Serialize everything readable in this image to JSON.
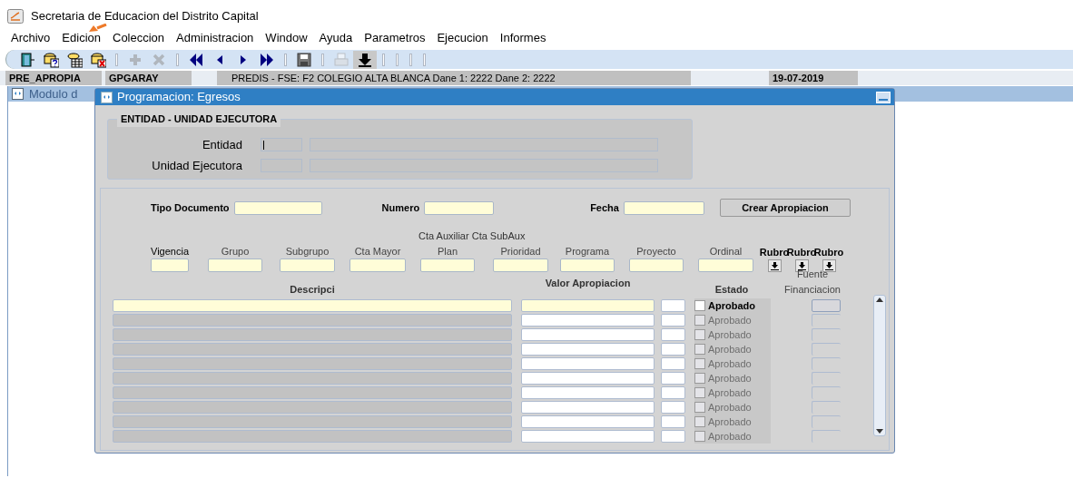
{
  "window": {
    "title": "Secretaria de Educacion del Distrito Capital"
  },
  "menu": [
    {
      "label": "Archivo"
    },
    {
      "label": "Edicion"
    },
    {
      "label": "Coleccion"
    },
    {
      "label": "Administracion"
    },
    {
      "label": "Window"
    },
    {
      "label": "Ayuda"
    },
    {
      "label": "Parametros"
    },
    {
      "label": "Ejecucion"
    },
    {
      "label": "Informes"
    }
  ],
  "toolbar": [
    {
      "kind": "exit",
      "disabled": false
    },
    {
      "kind": "query",
      "disabled": false
    },
    {
      "kind": "execute",
      "disabled": false
    },
    {
      "kind": "cancel",
      "disabled": false
    },
    {
      "kind": "separator",
      "disabled": false
    },
    {
      "kind": "add",
      "disabled": true
    },
    {
      "kind": "remove",
      "disabled": true
    },
    {
      "kind": "separator",
      "disabled": false
    },
    {
      "kind": "first",
      "disabled": false
    },
    {
      "kind": "prev",
      "disabled": false
    },
    {
      "kind": "next",
      "disabled": false
    },
    {
      "kind": "last",
      "disabled": false
    },
    {
      "kind": "separator",
      "disabled": false
    },
    {
      "kind": "save",
      "disabled": false
    },
    {
      "kind": "separator",
      "disabled": false
    },
    {
      "kind": "print",
      "disabled": true
    },
    {
      "kind": "download",
      "disabled": false
    },
    {
      "kind": "separator",
      "disabled": false
    },
    {
      "kind": "separator",
      "disabled": false
    },
    {
      "kind": "separator",
      "disabled": false
    },
    {
      "kind": "separator",
      "disabled": false
    }
  ],
  "status_bar": {
    "form": "PRE_APROPIA",
    "user": "GPGARAY",
    "context": "PREDIS - FSE: F2 COLEGIO ALTA BLANCA Dane 1: 2222 Dane 2: 2222",
    "date": "19-07-2019"
  },
  "background_window": {
    "title": "Modulo d"
  },
  "dialog": {
    "title": "Programacion: Egresos",
    "entity_section": {
      "title": "ENTIDAD - UNIDAD EJECUTORA",
      "fields": [
        {
          "label": "Entidad",
          "focused": true
        },
        {
          "label": "Unidad Ejecutora",
          "focused": false
        }
      ]
    },
    "header_fields": [
      {
        "label": "Tipo Documento"
      },
      {
        "label": "Numero"
      },
      {
        "label": "Fecha"
      }
    ],
    "create_button": "Crear Apropiacion",
    "account_columns": [
      {
        "label": "Vigencia",
        "strong": true
      },
      {
        "label": "Grupo",
        "strong": false
      },
      {
        "label": "Subgrupo",
        "strong": false
      },
      {
        "label": "Cta Mayor",
        "strong": false
      },
      {
        "label": "Plan",
        "strong": false
      },
      {
        "label": "Prioridad",
        "strong": false
      },
      {
        "label": "Programa",
        "strong": false
      },
      {
        "label": "Proyecto",
        "strong": false
      },
      {
        "label": "Ordinal",
        "strong": false
      }
    ],
    "account_caption": "Cta Auxiliar Cta SubAux",
    "rubro_buttons": [
      {
        "label": "Rubro"
      },
      {
        "label": "Rubro"
      },
      {
        "label": "Rubro"
      }
    ],
    "grid_columns": {
      "description": "Descripci",
      "value": "Valor Apropiacion",
      "status": "Estado",
      "source_top": "Fuente",
      "source": "Financiacion"
    },
    "rows": [
      {
        "disabled": false,
        "checked": false,
        "status": "Aprobado"
      },
      {
        "disabled": true,
        "checked": false,
        "status": "Aprobado"
      },
      {
        "disabled": true,
        "checked": false,
        "status": "Aprobado"
      },
      {
        "disabled": true,
        "checked": false,
        "status": "Aprobado"
      },
      {
        "disabled": true,
        "checked": false,
        "status": "Aprobado"
      },
      {
        "disabled": true,
        "checked": false,
        "status": "Aprobado"
      },
      {
        "disabled": true,
        "checked": false,
        "status": "Aprobado"
      },
      {
        "disabled": true,
        "checked": false,
        "status": "Aprobado"
      },
      {
        "disabled": true,
        "checked": false,
        "status": "Aprobado"
      },
      {
        "disabled": true,
        "checked": false,
        "status": "Aprobado"
      }
    ]
  }
}
